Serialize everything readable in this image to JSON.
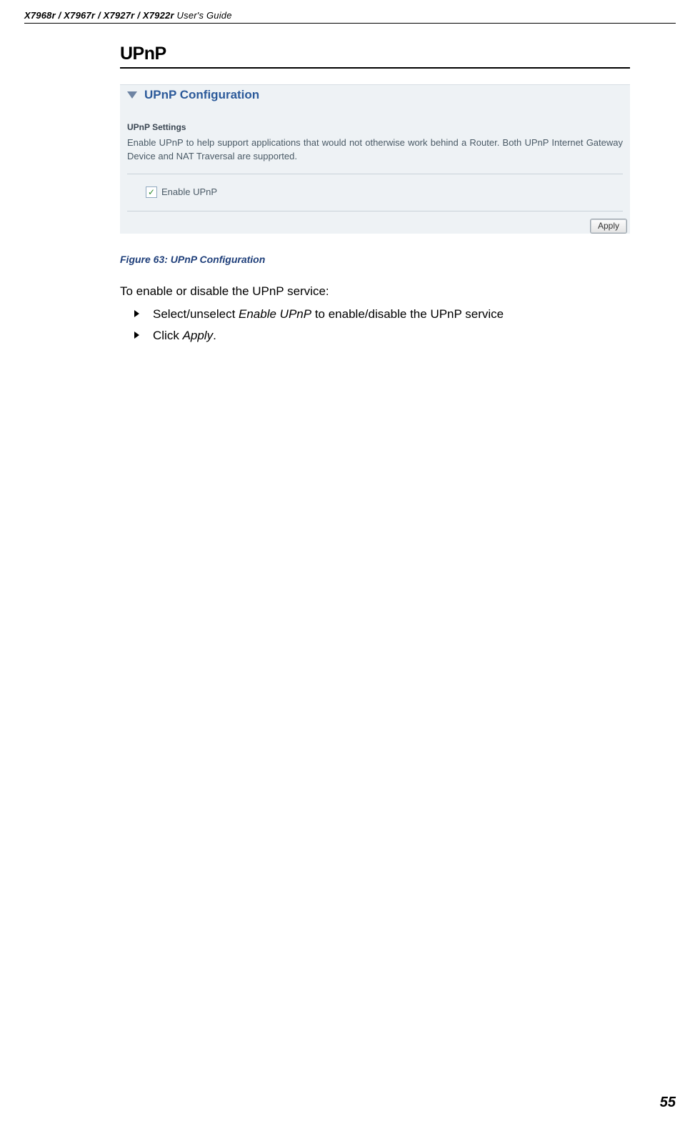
{
  "header": {
    "models": "X7968r / X7967r / X7927r / X7922r",
    "suffix": " User's Guide"
  },
  "section_title": "UPnP",
  "panel": {
    "title": "UPnP Configuration",
    "settings_heading": "UPnP Settings",
    "description": "Enable UPnP to help support applications that would not otherwise work behind a Router. Both UPnP Internet Gateway Device and NAT Traversal are supported.",
    "checkbox_label": "Enable UPnP",
    "checkbox_checked_glyph": "✓",
    "apply_label": "Apply"
  },
  "figure_caption": "Figure 63: UPnP Configuration",
  "instruction": "To enable or disable the UPnP service:",
  "bullets": [
    {
      "pre": "Select/unselect ",
      "em": "Enable UPnP",
      "post": " to enable/disable the UPnP service"
    },
    {
      "pre": "Click ",
      "em": "Apply",
      "post": "."
    }
  ],
  "page_number": "55"
}
